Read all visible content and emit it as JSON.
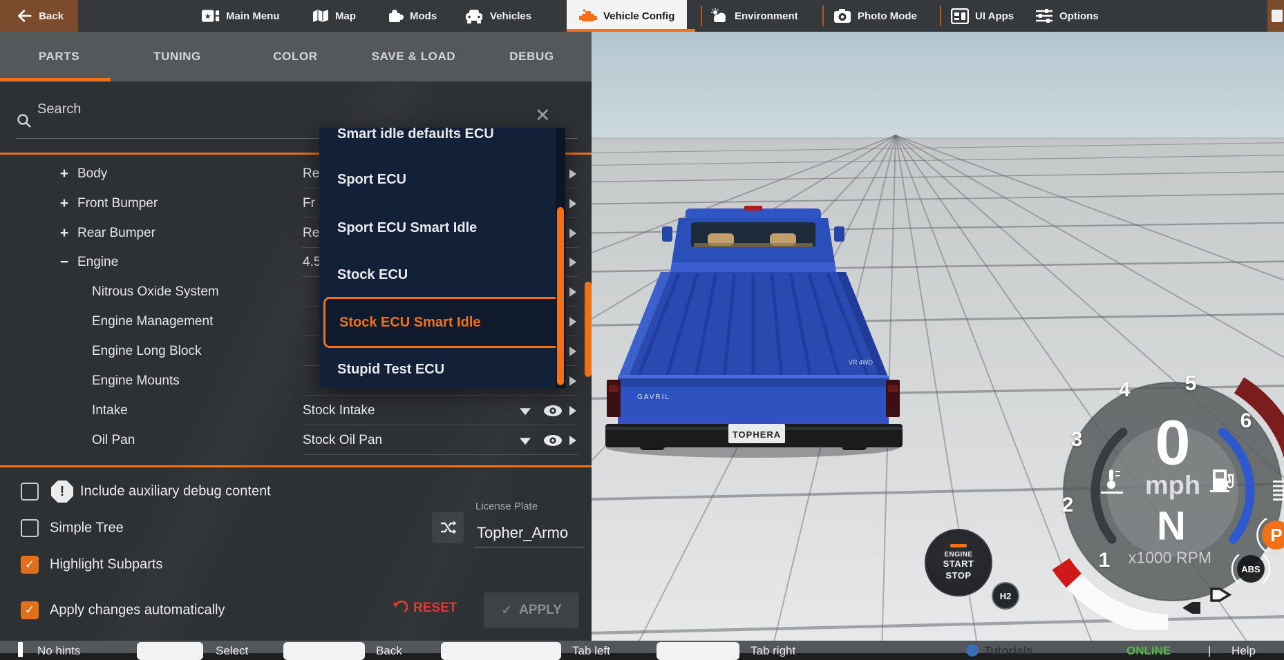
{
  "menubar": {
    "back_label": "Back",
    "items": [
      {
        "label": "Main Menu"
      },
      {
        "label": "Map"
      },
      {
        "label": "Mods"
      },
      {
        "label": "Vehicles"
      },
      {
        "label": "Vehicle Config",
        "active": true
      },
      {
        "label": "Environment"
      },
      {
        "label": "Photo Mode"
      },
      {
        "label": "UI Apps"
      },
      {
        "label": "Options"
      }
    ]
  },
  "tabs": {
    "items": [
      "PARTS",
      "TUNING",
      "COLOR",
      "SAVE & LOAD",
      "DEBUG"
    ],
    "active": "PARTS"
  },
  "search": {
    "placeholder": "Search"
  },
  "parts": {
    "rows": [
      {
        "glyph": "+",
        "label": "Body",
        "value": "Re"
      },
      {
        "glyph": "+",
        "label": "Front Bumper",
        "value": "Fr"
      },
      {
        "glyph": "+",
        "label": "Rear Bumper",
        "value": "Re"
      },
      {
        "glyph": "−",
        "label": "Engine",
        "value": "4.5"
      },
      {
        "glyph": "",
        "label": "Nitrous Oxide System",
        "value": ""
      },
      {
        "glyph": "",
        "label": "Engine Management",
        "value": ""
      },
      {
        "glyph": "",
        "label": "Engine Long Block",
        "value": ""
      },
      {
        "glyph": "",
        "label": "Engine Mounts",
        "value": ""
      },
      {
        "glyph": "",
        "label": "Intake",
        "value": "Stock Intake"
      },
      {
        "glyph": "",
        "label": "Oil Pan",
        "value": "Stock Oil Pan"
      }
    ]
  },
  "dropdown": {
    "close_glyph": "✕",
    "options": [
      "Smart idle defaults ECU",
      "Sport ECU",
      "Sport ECU Smart Idle",
      "Stock ECU",
      "Stock ECU Smart Idle",
      "Stupid Test ECU"
    ],
    "selected": "Stock ECU Smart Idle"
  },
  "options_panel": {
    "checkboxes": [
      {
        "label": "Include auxiliary debug content",
        "checked": false
      },
      {
        "label": "Simple Tree",
        "checked": false
      },
      {
        "label": "Highlight Subparts",
        "checked": true
      },
      {
        "label": "Apply changes automatically",
        "checked": true
      }
    ],
    "check_glyph": "✓",
    "warning_glyph": "!",
    "license_label": "License Plate",
    "license_value": "Topher_Armo",
    "reset_label": "RESET",
    "apply_label": "APPLY"
  },
  "hintbar": {
    "items": [
      "No hints",
      "Select",
      "Back",
      "Tab left",
      "Tab right"
    ],
    "info": "Tutorials",
    "online": "ONLINE",
    "divider": "|",
    "help": "Help"
  },
  "scene": {
    "truck_brand": "GAVRIL",
    "truck_plate": "TOPHERA",
    "truck_badge": "VR 4WD",
    "start_button": [
      "ENGINE",
      "START",
      "STOP"
    ],
    "h2_label": "H2"
  },
  "gauge": {
    "rpm_marks": [
      "1",
      "2",
      "3",
      "4",
      "5",
      "6"
    ],
    "speed": "0",
    "unit": "mph",
    "gear": "N",
    "scale_label": "x1000 RPM",
    "abs_label": "ABS",
    "park_label": "P"
  },
  "colors": {
    "accent": "#f07117",
    "dropdown_bg": "#132138",
    "reset_red": "#e23434",
    "online_green": "#56b54a",
    "truck_blue": "#2f53c0",
    "sky_top": "#b6c8d0",
    "ground": "#cfd2d3"
  }
}
